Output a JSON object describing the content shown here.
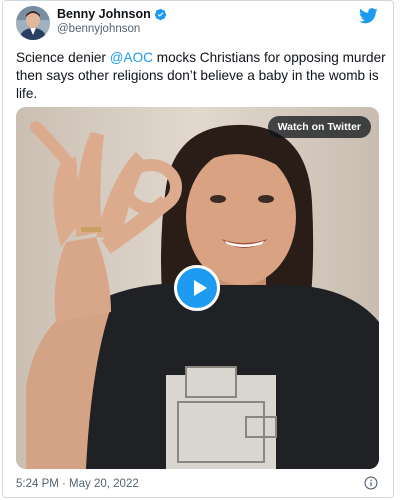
{
  "author": {
    "display_name": "Benny Johnson",
    "handle": "@bennyjohnson"
  },
  "tweet": {
    "text_before": "Science denier ",
    "mention": "@AOC",
    "text_after": " mocks Christians for opposing murder then says other religions don’t believe a baby in the womb is life."
  },
  "media": {
    "watch_label": "Watch on Twitter"
  },
  "footer": {
    "timestamp": "5:24 PM · May 20, 2022"
  },
  "colors": {
    "accent": "#1d9bf0",
    "text": "#0f1419",
    "muted": "#536471"
  },
  "icons": {
    "verified": "verified-badge-icon",
    "twitter": "twitter-bird-icon",
    "play": "play-icon",
    "info": "info-icon"
  }
}
